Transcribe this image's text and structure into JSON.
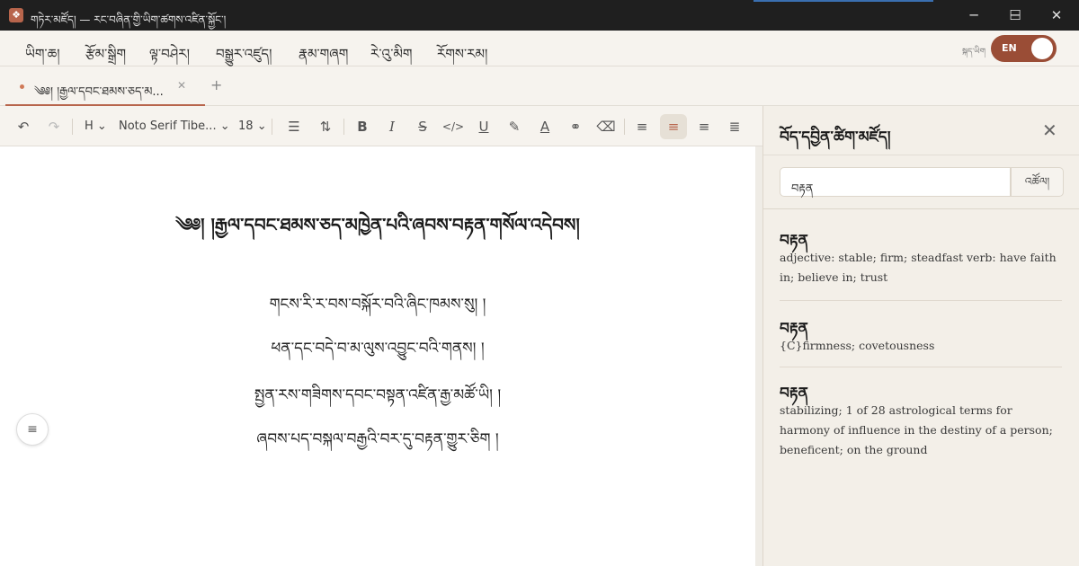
{
  "window": {
    "title": "གཏེར་མཛོད། — རང་བཞིན་གྱི་ཡིག་ཚགས་འཛིན་སྐྱོང་།",
    "app_icon": "app-logo-icon",
    "controls": [
      "minimize-icon",
      "maximize-icon",
      "close-icon"
    ]
  },
  "menu": {
    "items": [
      "ཡིག་ཆ།",
      "རྩོམ་སྒྲིག",
      "ལྟ་བཤེར།",
      "བསྒྱུར་འཛུད།",
      "རྣམ་གཞག",
      "རེ་འུ་མིག",
      "རོགས་རམ།"
    ],
    "lang_label": "སྐད་ཡིག",
    "lang_toggle": "EN"
  },
  "tabs": {
    "active_label": "༄༅། །རྒྱལ་དབང་ཐམས་ཅད་མ...",
    "close_glyph": "✕",
    "add_glyph": "+"
  },
  "toolbar": {
    "heading_label": "H",
    "font_family": "Noto Serif Tibe...",
    "font_size": "18",
    "dropdown_glyph": "⌄",
    "active_align": "center"
  },
  "document": {
    "title": "༄༅། །རྒྱལ་དབང་ཐམས་ཅད་མཁྱེན་པའི་ཞབས་བརྟན་གསོལ་འདེབས།",
    "verses": [
      "གངས་རི་ར་བས་བསྐོར་བའི་ཞིང་ཁམས་སུ། །",
      "ཕན་དང་བདེ་བ་མ་ལུས་འབྱུང་བའི་གནས། །",
      "སྤྱན་རས་གཟིགས་དབང་བསྟན་འཛིན་རྒྱ་མཚོ་ཡི། །",
      "ཞབས་པད་བསྐལ་བརྒྱའི་བར་དུ་བརྟན་གྱུར་ཅིག །"
    ]
  },
  "dictionary": {
    "title": "བོད་དབྱིན་ཚིག་མཛོད།",
    "search_value": "བརྟན",
    "search_button": "འཚོལ།",
    "entries": [
      {
        "word": "བརྟན",
        "definition": "adjective: stable; firm; steadfast verb: have faith in; believe in; trust"
      },
      {
        "word": "བརྟན",
        "definition": "{C}firmness; covetousness"
      },
      {
        "word": "བརྟན",
        "definition": "stabilizing; 1 of 28 astrological terms for harmony of influence in the destiny of a person; beneficent; on the ground"
      }
    ]
  },
  "colors": {
    "accent": "#b8654c",
    "toggle": "#9a4d36",
    "panel_bg": "#f3efe8"
  }
}
